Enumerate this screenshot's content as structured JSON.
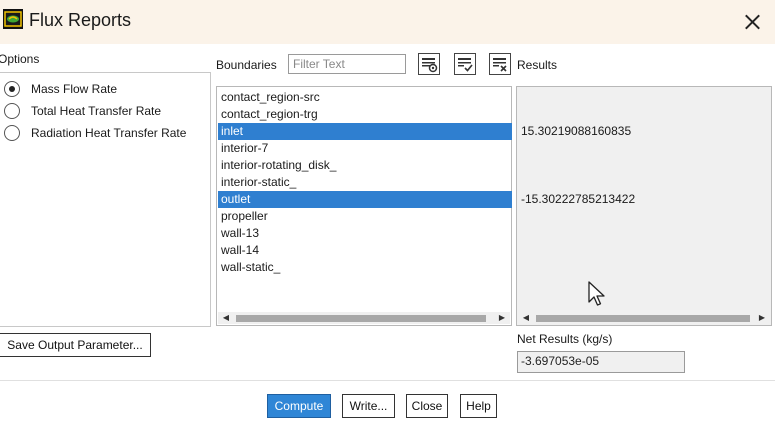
{
  "window": {
    "title": "Flux Reports",
    "icon": "ansys-fluent-icon"
  },
  "options": {
    "label": "Options",
    "items": [
      {
        "label": "Mass Flow Rate",
        "checked": true
      },
      {
        "label": "Total Heat Transfer Rate",
        "checked": false
      },
      {
        "label": "Radiation Heat Transfer Rate",
        "checked": false
      }
    ]
  },
  "boundaries": {
    "label": "Boundaries",
    "filter_placeholder": "Filter Text",
    "toolbar_icons": [
      "new-group-icon",
      "select-all-icon",
      "deselect-all-icon"
    ],
    "items": [
      {
        "label": "contact_region-src",
        "selected": false
      },
      {
        "label": "contact_region-trg",
        "selected": false
      },
      {
        "label": "inlet",
        "selected": true
      },
      {
        "label": "interior-7",
        "selected": false
      },
      {
        "label": "interior-rotating_disk_",
        "selected": false
      },
      {
        "label": "interior-static_",
        "selected": false
      },
      {
        "label": "outlet",
        "selected": true
      },
      {
        "label": "propeller",
        "selected": false
      },
      {
        "label": "wall-13",
        "selected": false
      },
      {
        "label": "wall-14",
        "selected": false
      },
      {
        "label": "wall-static_",
        "selected": false
      }
    ]
  },
  "results": {
    "label": "Results",
    "values": [
      {
        "row": 2,
        "text": "15.30219088160835"
      },
      {
        "row": 6,
        "text": "-15.30222785213422"
      }
    ],
    "net_label": "Net Results (kg/s)",
    "net_value": "-3.697053e-05"
  },
  "actions": {
    "save_output": "Save Output Parameter...",
    "compute": "Compute",
    "write": "Write...",
    "close": "Close",
    "help": "Help"
  },
  "colors": {
    "selection": "#2f7fd0",
    "primary_button": "#2f86d6",
    "titlebar": "#fbf3e9"
  }
}
